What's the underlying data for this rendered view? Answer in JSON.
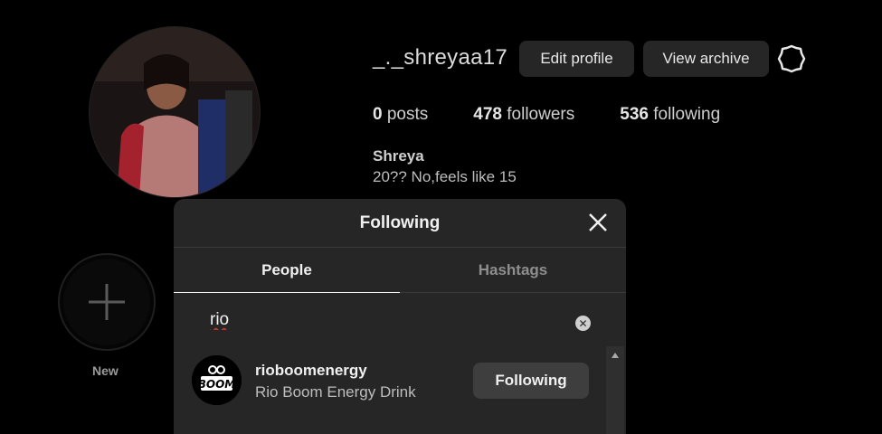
{
  "profile": {
    "username": "_._shreyaa17",
    "edit_label": "Edit profile",
    "archive_label": "View archive",
    "posts_count": "0",
    "posts_label": "posts",
    "followers_count": "478",
    "followers_label": "followers",
    "following_count": "536",
    "following_label": "following",
    "full_name": "Shreya",
    "bio": "20?? No,feels like 15"
  },
  "highlights": {
    "new_label": "New"
  },
  "modal": {
    "title": "Following",
    "tabs": [
      {
        "label": "People",
        "active": true
      },
      {
        "label": "Hashtags",
        "active": false
      }
    ],
    "search_value": "rio",
    "results": [
      {
        "username": "rioboomenergy",
        "subtitle": "Rio Boom Energy Drink",
        "button_label": "Following",
        "logo_text": "BOOM"
      }
    ]
  },
  "colors": {
    "background": "#000000",
    "modal": "#262626",
    "button": "#262626"
  },
  "icons": [
    "gear-icon",
    "close-icon",
    "plus-icon",
    "clear-search-icon"
  ]
}
